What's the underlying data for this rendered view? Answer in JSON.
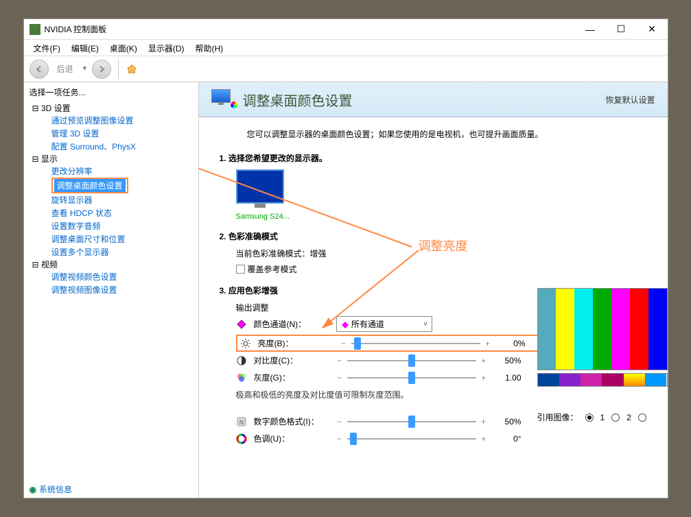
{
  "title": "NVIDIA 控制面板",
  "menubar": [
    "文件(F)",
    "编辑(E)",
    "桌面(K)",
    "显示器(D)",
    "帮助(H)"
  ],
  "toolbar": {
    "back_label": "后退"
  },
  "sidebar": {
    "task_title": "选择一项任务...",
    "groups": [
      {
        "label": "3D 设置",
        "items": [
          "通过预览调整图像设置",
          "管理 3D 设置",
          "配置 Surround、PhysX"
        ]
      },
      {
        "label": "显示",
        "items": [
          "更改分辨率",
          "调整桌面颜色设置",
          "旋转显示器",
          "查看 HDCP 状态",
          "设置数字音频",
          "调整桌面尺寸和位置",
          "设置多个显示器"
        ]
      },
      {
        "label": "视频",
        "items": [
          "调整视频颜色设置",
          "调整视频图像设置"
        ]
      }
    ],
    "selected": "调整桌面颜色设置",
    "sysinfo": "系统信息"
  },
  "page": {
    "title": "调整桌面颜色设置",
    "restore": "恢复默认设置",
    "desc": "您可以调整显示器的桌面颜色设置；如果您使用的是电视机，也可提升画面质量。",
    "section1": {
      "num": "1.",
      "title": "选择您希望更改的显示器。",
      "monitor": "Samsung S24..."
    },
    "section2": {
      "num": "2.",
      "title": "色彩准确模式",
      "current": "当前色彩准确模式：增强",
      "override": "覆盖参考模式"
    },
    "section3": {
      "num": "3.",
      "title": "应用色彩增强",
      "output": "输出调整",
      "channel_label": "颜色通道(N)：",
      "channel_value": "所有通道",
      "channel_icon_color": "#aa44cc",
      "sliders": [
        {
          "icon": "sun",
          "label": "亮度(B)：",
          "value": "0%",
          "pos": 5,
          "highlight": true
        },
        {
          "icon": "contrast",
          "label": "对比度(C)：",
          "value": "50%",
          "pos": 50
        },
        {
          "icon": "gamma",
          "label": "灰度(G)：",
          "value": "1.00",
          "pos": 50
        }
      ],
      "hint": "极高和极低的亮度及对比度值可限制灰度范围。",
      "sliders2": [
        {
          "icon": "nv",
          "label": "数字颜色格式(I)：",
          "value": "50%",
          "pos": 50
        },
        {
          "icon": "hue",
          "label": "色调(U)：",
          "value": "0°",
          "pos": 5
        }
      ]
    },
    "annotation": "调整亮度",
    "reference": {
      "label": "引用图像：",
      "options": [
        "1",
        "2"
      ],
      "selected": 0
    }
  },
  "colorbars": [
    "#5aa",
    "#ff0",
    "#0ff",
    "#0a0",
    "#f0f",
    "#f00",
    "#00f",
    "#fff",
    "#000"
  ]
}
